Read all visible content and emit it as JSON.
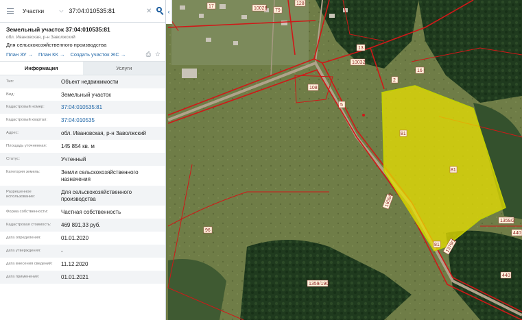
{
  "search": {
    "layer": "Участки",
    "query": "37:04:010535:81"
  },
  "object": {
    "title": "Земельный участок 37:04:010535:81",
    "address": "обл. Ивановская, р-н Заволжский",
    "purpose": "Для сельскохозяйственного производства",
    "links": [
      {
        "label": "План ЗУ →"
      },
      {
        "label": "План КК →"
      },
      {
        "label": "Создать участок ЖС →"
      }
    ]
  },
  "tabs": [
    {
      "label": "Информация",
      "active": true
    },
    {
      "label": "Услуги",
      "active": false
    }
  ],
  "fields": [
    {
      "label": "Тип:",
      "value": "Объект недвижимости",
      "link": false
    },
    {
      "label": "Вид:",
      "value": "Земельный участок",
      "link": false
    },
    {
      "label": "Кадастровый номер:",
      "value": "37:04:010535:81",
      "link": true
    },
    {
      "label": "Кадастровый квартал:",
      "value": "37:04:010535",
      "link": true
    },
    {
      "label": "Адрес:",
      "value": "обл. Ивановская, р-н Заволжский",
      "link": false
    },
    {
      "label": "Площадь уточненная:",
      "value": "145 854 кв. м",
      "link": false
    },
    {
      "label": "Статус:",
      "value": "Учтенный",
      "link": false
    },
    {
      "label": "Категория земель:",
      "value": "Земли сельскохозяйственного назначения",
      "link": false
    },
    {
      "label": "Разрешенное использование:",
      "value": "Для сельскохозяйственного производства",
      "link": false
    },
    {
      "label": "Форма собственности:",
      "value": "Частная собственность",
      "link": false
    },
    {
      "label": "Кадастровая стоимость:",
      "value": "469 891,33 руб.",
      "link": false
    },
    {
      "label": "дата определения:",
      "value": "01.01.2020",
      "link": false
    },
    {
      "label": "дата утверждения:",
      "value": "-",
      "link": false
    },
    {
      "label": "дата внесения сведений:",
      "value": "11.12.2020",
      "link": false
    },
    {
      "label": "дата применения:",
      "value": "01.01.2021",
      "link": false
    }
  ],
  "map": {
    "labels": [
      "17",
      "10026",
      "79",
      "128",
      "13",
      "10032",
      "108",
      "2",
      "16",
      "81",
      "81",
      "81",
      "1659/2",
      "1359/2",
      "1379/1",
      "440",
      "96",
      "1359/190",
      "440",
      "5"
    ],
    "colors": {
      "parcel_border": "#d01818",
      "selected_fill": "#e8e000",
      "road": "#b0a28a"
    }
  }
}
